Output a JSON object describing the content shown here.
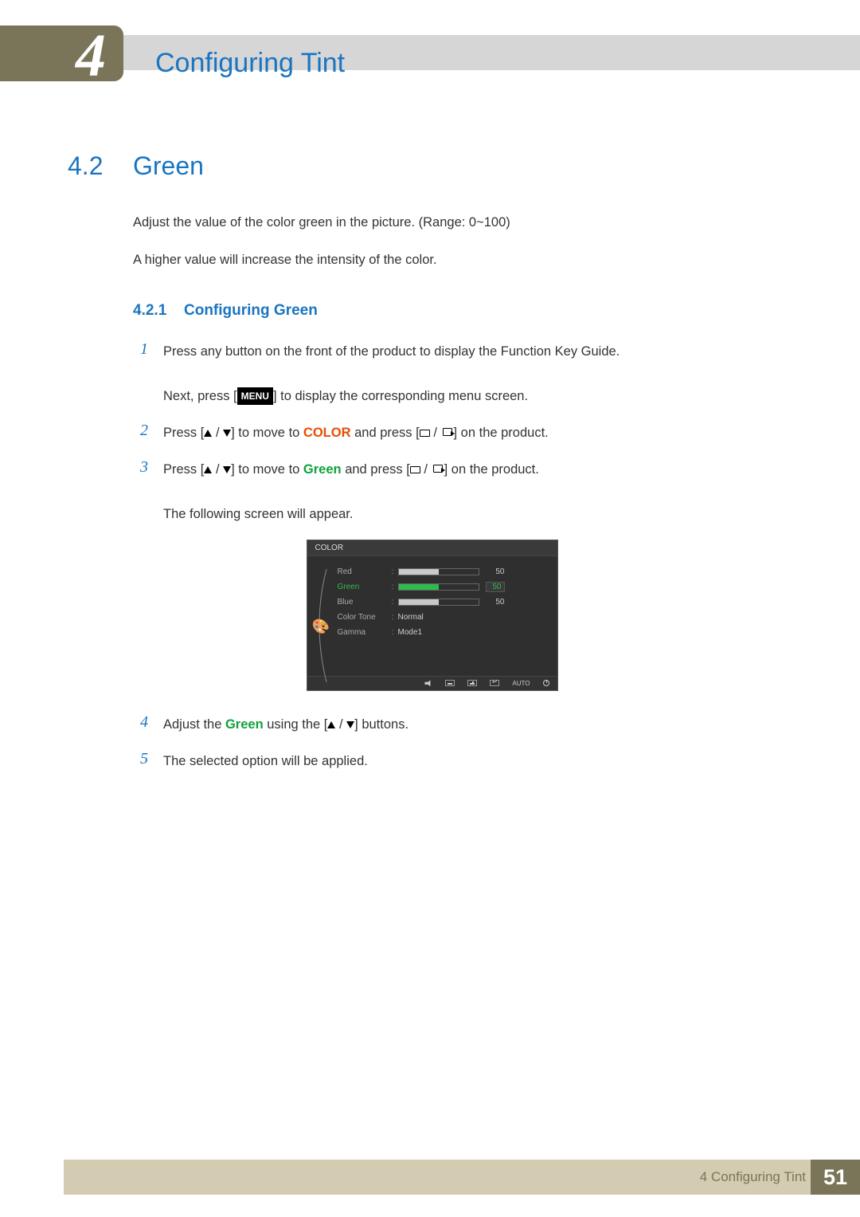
{
  "chapter": {
    "number": "4",
    "title": "Configuring Tint"
  },
  "section": {
    "number": "4.2",
    "title": "Green"
  },
  "intro": {
    "p1": "Adjust the value of the color green in the picture. (Range: 0~100)",
    "p2": "A higher value will increase the intensity of the color."
  },
  "subsection": {
    "number": "4.2.1",
    "title": "Configuring Green"
  },
  "menu_label": "MENU",
  "steps": {
    "s1a": "Press any button on the front of the product to display the Function Key Guide.",
    "s1b_pre": "Next, press [",
    "s1b_post": "] to display the corresponding menu screen.",
    "s2_pre": "Press [",
    "s2_mid1": "] to move to ",
    "s2_color": "COLOR",
    "s2_mid2": " and press [",
    "s2_post": "] on the product.",
    "s3_pre": "Press [",
    "s3_mid1": "] to move to ",
    "s3_green": "Green",
    "s3_mid2": " and press [",
    "s3_post": "] on the product.",
    "s3_follow": "The following screen will appear.",
    "s4_pre": "Adjust the ",
    "s4_green": "Green",
    "s4_mid": " using the [",
    "s4_post": "] buttons.",
    "s5": "The selected option will be applied."
  },
  "step_nums": {
    "n1": "1",
    "n2": "2",
    "n3": "3",
    "n4": "4",
    "n5": "5"
  },
  "osd": {
    "title": "COLOR",
    "rows": [
      {
        "label": "Red",
        "value": "50",
        "fill": 50
      },
      {
        "label": "Green",
        "value": "50",
        "fill": 50,
        "selected": true
      },
      {
        "label": "Blue",
        "value": "50",
        "fill": 50
      }
    ],
    "opts": [
      {
        "label": "Color Tone",
        "value": "Normal"
      },
      {
        "label": "Gamma",
        "value": "Mode1"
      }
    ],
    "footer_auto": "AUTO"
  },
  "footer": {
    "text": "4 Configuring Tint",
    "page": "51"
  }
}
